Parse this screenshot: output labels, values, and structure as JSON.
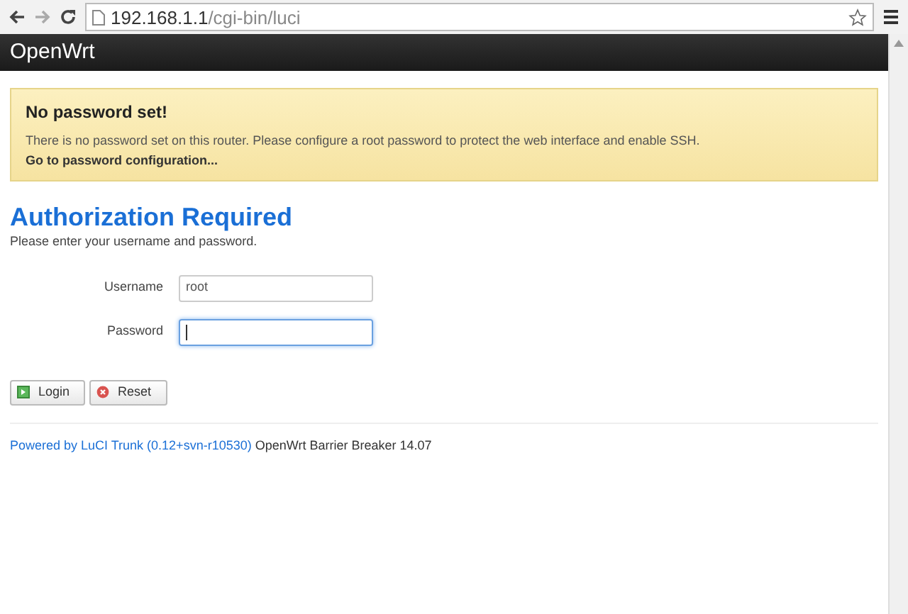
{
  "browser": {
    "url_host": "192.168.1.1",
    "url_path": "/cgi-bin/luci"
  },
  "header": {
    "brand": "OpenWrt"
  },
  "alert": {
    "title": "No password set!",
    "message": "There is no password set on this router. Please configure a root password to protect the web interface and enable SSH.",
    "link": "Go to password configuration..."
  },
  "title": "Authorization Required",
  "subtitle": "Please enter your username and password.",
  "fields": [
    {
      "label": "Username",
      "value": "root",
      "focused": false
    },
    {
      "label": "Password",
      "focused": true
    }
  ],
  "buttons": [
    {
      "label": "Login",
      "kind": "login"
    },
    {
      "label": "Reset",
      "kind": "reset"
    }
  ],
  "footer": {
    "link": "Powered by LuCI Trunk (0.12+svn-r10530)",
    "text": "OpenWrt Barrier Breaker 14.07"
  }
}
